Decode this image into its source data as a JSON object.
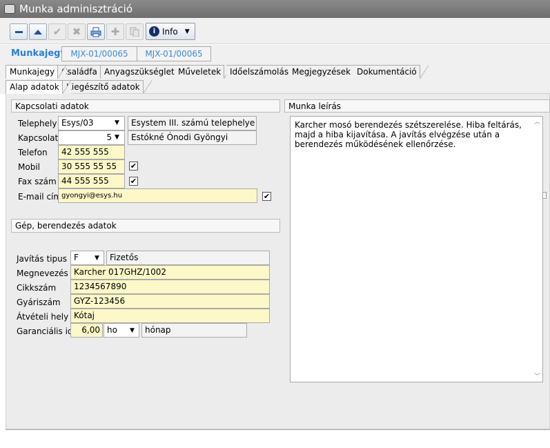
{
  "window": {
    "title": "Munka adminisztráció"
  },
  "toolbar": {
    "info_label": "Info",
    "buttons": [
      "minus-icon",
      "up-triangle-icon",
      "check-icon",
      "close-icon",
      "print-icon",
      "plus-icon",
      "copy-icon"
    ]
  },
  "header": {
    "label": "Munkajegy",
    "code1": "MJX-01/00065",
    "code2": "MJX-01/00065"
  },
  "tabs": [
    "Munkajegy",
    "Családfa",
    "Anyagszükséglet",
    "Műveletek",
    "Időelszámolás",
    "Megjegyzések",
    "Dokumentáció"
  ],
  "subtabs": [
    "Alap adatok",
    "Kiegészítő adatok"
  ],
  "contact": {
    "section_title": "Kapcsolati adatok",
    "telephely_label": "Telephely",
    "telephely_value": "Esys/03",
    "telephely_desc": "Esystem III. számú telephelye",
    "kapcsolat_label": "Kapcsolat",
    "kapcsolat_value": "5",
    "kapcsolat_desc": "Estókné Ónodi Gyöngyi",
    "telefon_label": "Telefon",
    "telefon_value": "42 555 555",
    "mobil_label": "Mobil",
    "mobil_value": "30 555 55 55",
    "mobil_checked": true,
    "fax_label": "Fax szám",
    "fax_value": "44 555 555",
    "fax_checked": true,
    "email_label": "E-mail cím",
    "email_value": "gyongyi@esys.hu",
    "email_checked": true
  },
  "machine": {
    "section_title": "Gép, berendezés adatok",
    "javitas_label": "Javítás tipus",
    "javitas_value": "F",
    "javitas_desc": "Fizetős",
    "megnevezes_label": "Megnevezés",
    "megnevezes_value": "Karcher 017GHZ/1002",
    "cikkszam_label": "Cikkszám",
    "cikkszam_value": "1234567890",
    "gyariszam_label": "Gyáriszám",
    "gyariszam_value": "GYZ-123456",
    "atveteli_label": "Átvételi hely",
    "atveteli_value": "Kótaj",
    "garancia_label": "Garanciális idő",
    "garancia_value": "6,00",
    "garancia_unit": "ho",
    "garancia_unit_desc": "hónap"
  },
  "work": {
    "section_title": "Munka leírás",
    "description": "Karcher mosó berendezés szétszerelése. Hiba feltárás, majd a hiba kijavítása. A javítás elvégzése után a berendezés működésének ellenőrzése."
  }
}
